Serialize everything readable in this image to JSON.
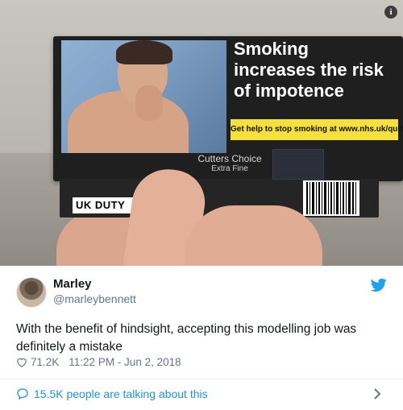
{
  "photo": {
    "warning_text": "Smoking increases the risk of impotence",
    "help_text": "Get help to stop smoking at www.nhs.uk/quit",
    "brand_line1": "Cutters Choice",
    "brand_line2": "Extra Fine",
    "duty_label": "UK DUTY",
    "info_icon": "i"
  },
  "tweet": {
    "display_name": "Marley",
    "handle": "@marleybennett",
    "text": "With the benefit of hindsight, accepting this modelling job was definitely a mistake",
    "likes": "71.2K",
    "timestamp": "11:22 PM - Jun 2, 2018",
    "conversation": "15.5K people are talking about this"
  },
  "colors": {
    "twitter_blue": "#1da1f2",
    "link_blue": "#1b95e0",
    "warning_yellow": "#f6e03a"
  },
  "icons": [
    "info-icon",
    "twitter-bird-icon",
    "heart-icon",
    "chat-bubble-icon",
    "chevron-right-icon"
  ]
}
